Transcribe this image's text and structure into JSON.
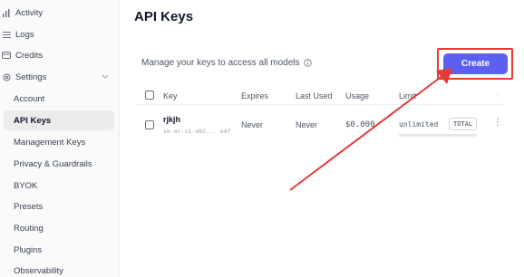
{
  "sidebar": {
    "items": [
      {
        "label": "Activity",
        "icon": "activity-icon"
      },
      {
        "label": "Logs",
        "icon": "logs-icon"
      },
      {
        "label": "Credits",
        "icon": "credits-icon"
      },
      {
        "label": "Settings",
        "icon": "settings-icon"
      },
      {
        "label": "Account"
      },
      {
        "label": "API Keys"
      },
      {
        "label": "Management Keys"
      },
      {
        "label": "Privacy & Guardrails"
      },
      {
        "label": "BYOK"
      },
      {
        "label": "Presets"
      },
      {
        "label": "Routing"
      },
      {
        "label": "Plugins"
      },
      {
        "label": "Observability"
      }
    ],
    "active": "API Keys"
  },
  "main": {
    "title": "API Keys",
    "subtitle": "Manage your keys to access all models",
    "create_label": "Create",
    "table": {
      "headers": {
        "key": "Key",
        "expires": "Expires",
        "last_used": "Last Used",
        "usage": "Usage",
        "limit": "Limit"
      },
      "rows": [
        {
          "name": "rjkjh",
          "key_preview": "sk-or-v1-a92... e4f",
          "expires": "Never",
          "last_used": "Never",
          "usage": "$0.000",
          "limit": "unlimited",
          "limit_type": "TOTAL"
        }
      ]
    }
  },
  "colors": {
    "accent": "#5b5ff2",
    "annotation": "#e53935"
  }
}
